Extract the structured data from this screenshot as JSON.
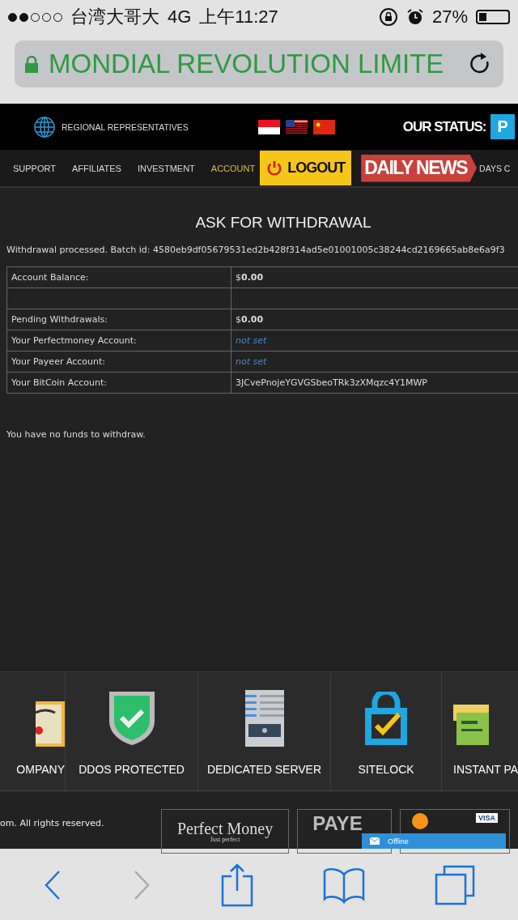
{
  "status_bar": {
    "carrier": "台湾大哥大",
    "network": "4G",
    "time": "上午11:27",
    "battery_text": "27%",
    "battery": {
      "level": 0.27
    }
  },
  "url_bar": {
    "title": "MONDIAL REVOLUTION LIMITE"
  },
  "header": {
    "regional": "REGIONAL REPRESENTATIVES",
    "status_label": "OUR STATUS:",
    "status_badge": "P"
  },
  "nav": [
    {
      "label": "SUPPORT",
      "selected": false
    },
    {
      "label": "AFFILIATES",
      "selected": false
    },
    {
      "label": "INVESTMENT",
      "selected": false
    },
    {
      "label": "ACCOUNT",
      "selected": true
    }
  ],
  "logout": "LOGOUT",
  "daily_news": "DAILY NEWS",
  "nav_cut": "DAYS C",
  "page": {
    "title": "ASK FOR WITHDRAWAL",
    "message": "Withdrawal processed. Batch id: 4580eb9df05679531ed2b428f314ad5e01001005c38244cd2169665ab8e6a9f3",
    "rows": [
      {
        "kind": "money",
        "label": "Account Balance:",
        "value": "$**0.00**"
      },
      {
        "kind": "blank"
      },
      {
        "kind": "money",
        "label": "Pending Withdrawals:",
        "value": "$**0.00**"
      },
      {
        "kind": "notset",
        "label": "Your Perfectmoney Account:",
        "value": "not set"
      },
      {
        "kind": "notset",
        "label": "Your Payeer Account:",
        "value": "not set"
      },
      {
        "kind": "plain",
        "label": "Your BitCoin Account:",
        "value": "3JCvePnojeYGVGSbeoTRk3zXMqzc4Y1MWP"
      }
    ],
    "note": "You have no funds to withdraw."
  },
  "features": [
    {
      "kind": "certificate",
      "label": "OMPANY"
    },
    {
      "kind": "shield",
      "label": "DDOS PROTECTED"
    },
    {
      "kind": "server",
      "label": "DEDICATED SERVER"
    },
    {
      "kind": "lock",
      "label": "SITELOCK"
    },
    {
      "kind": "card",
      "label": "INSTANT PA"
    }
  ],
  "footer": {
    "copyright": "om. All rights reserved.",
    "perfect_money": "Perfect Money",
    "perfect_money_tag": "Just perfect",
    "payeer": "PAYE",
    "visa": "VISA",
    "chat": "Offline"
  }
}
